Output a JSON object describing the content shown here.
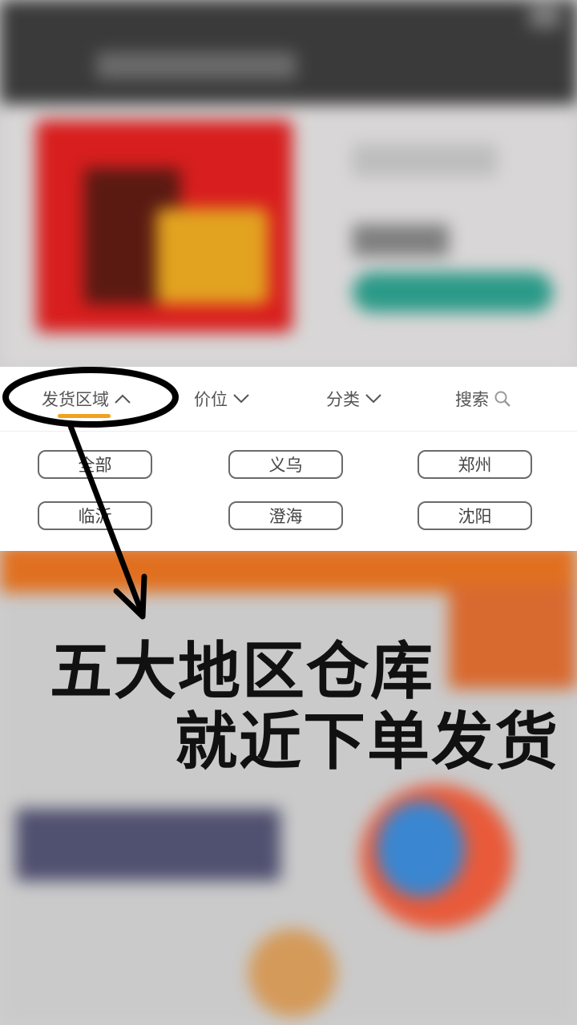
{
  "filter_tabs": {
    "region": "发货区域",
    "price": "价位",
    "category": "分类",
    "search": "搜索"
  },
  "regions": [
    "全部",
    "义乌",
    "郑州",
    "临沂",
    "澄海",
    "沈阳"
  ],
  "annotation": {
    "line1": "五大地区仓库",
    "line2": "就近下单发货"
  },
  "colors": {
    "accent": "#f2a01e",
    "chip_border": "#6a6a6a",
    "annotation": "#111111"
  },
  "icons": [
    "chevron-up-icon",
    "chevron-down-icon",
    "search-icon"
  ]
}
